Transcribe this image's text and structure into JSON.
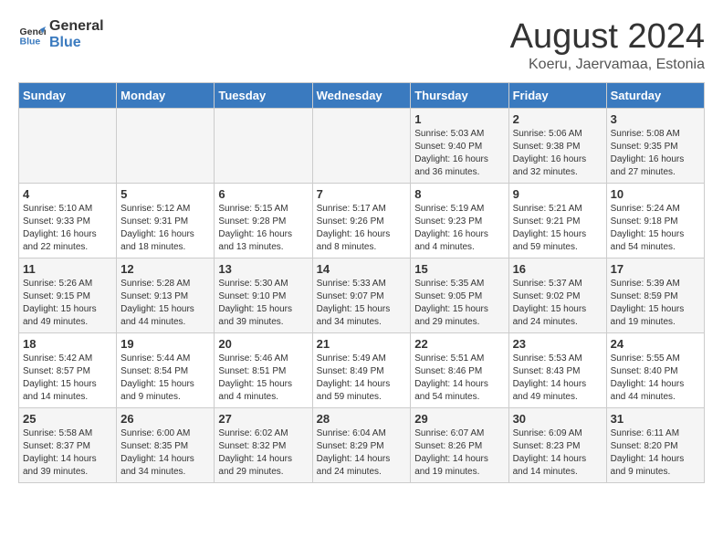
{
  "logo": {
    "line1": "General",
    "line2": "Blue"
  },
  "title": "August 2024",
  "subtitle": "Koeru, Jaervamaa, Estonia",
  "headers": [
    "Sunday",
    "Monday",
    "Tuesday",
    "Wednesday",
    "Thursday",
    "Friday",
    "Saturday"
  ],
  "weeks": [
    [
      {
        "day": "",
        "info": ""
      },
      {
        "day": "",
        "info": ""
      },
      {
        "day": "",
        "info": ""
      },
      {
        "day": "",
        "info": ""
      },
      {
        "day": "1",
        "info": "Sunrise: 5:03 AM\nSunset: 9:40 PM\nDaylight: 16 hours\nand 36 minutes."
      },
      {
        "day": "2",
        "info": "Sunrise: 5:06 AM\nSunset: 9:38 PM\nDaylight: 16 hours\nand 32 minutes."
      },
      {
        "day": "3",
        "info": "Sunrise: 5:08 AM\nSunset: 9:35 PM\nDaylight: 16 hours\nand 27 minutes."
      }
    ],
    [
      {
        "day": "4",
        "info": "Sunrise: 5:10 AM\nSunset: 9:33 PM\nDaylight: 16 hours\nand 22 minutes."
      },
      {
        "day": "5",
        "info": "Sunrise: 5:12 AM\nSunset: 9:31 PM\nDaylight: 16 hours\nand 18 minutes."
      },
      {
        "day": "6",
        "info": "Sunrise: 5:15 AM\nSunset: 9:28 PM\nDaylight: 16 hours\nand 13 minutes."
      },
      {
        "day": "7",
        "info": "Sunrise: 5:17 AM\nSunset: 9:26 PM\nDaylight: 16 hours\nand 8 minutes."
      },
      {
        "day": "8",
        "info": "Sunrise: 5:19 AM\nSunset: 9:23 PM\nDaylight: 16 hours\nand 4 minutes."
      },
      {
        "day": "9",
        "info": "Sunrise: 5:21 AM\nSunset: 9:21 PM\nDaylight: 15 hours\nand 59 minutes."
      },
      {
        "day": "10",
        "info": "Sunrise: 5:24 AM\nSunset: 9:18 PM\nDaylight: 15 hours\nand 54 minutes."
      }
    ],
    [
      {
        "day": "11",
        "info": "Sunrise: 5:26 AM\nSunset: 9:15 PM\nDaylight: 15 hours\nand 49 minutes."
      },
      {
        "day": "12",
        "info": "Sunrise: 5:28 AM\nSunset: 9:13 PM\nDaylight: 15 hours\nand 44 minutes."
      },
      {
        "day": "13",
        "info": "Sunrise: 5:30 AM\nSunset: 9:10 PM\nDaylight: 15 hours\nand 39 minutes."
      },
      {
        "day": "14",
        "info": "Sunrise: 5:33 AM\nSunset: 9:07 PM\nDaylight: 15 hours\nand 34 minutes."
      },
      {
        "day": "15",
        "info": "Sunrise: 5:35 AM\nSunset: 9:05 PM\nDaylight: 15 hours\nand 29 minutes."
      },
      {
        "day": "16",
        "info": "Sunrise: 5:37 AM\nSunset: 9:02 PM\nDaylight: 15 hours\nand 24 minutes."
      },
      {
        "day": "17",
        "info": "Sunrise: 5:39 AM\nSunset: 8:59 PM\nDaylight: 15 hours\nand 19 minutes."
      }
    ],
    [
      {
        "day": "18",
        "info": "Sunrise: 5:42 AM\nSunset: 8:57 PM\nDaylight: 15 hours\nand 14 minutes."
      },
      {
        "day": "19",
        "info": "Sunrise: 5:44 AM\nSunset: 8:54 PM\nDaylight: 15 hours\nand 9 minutes."
      },
      {
        "day": "20",
        "info": "Sunrise: 5:46 AM\nSunset: 8:51 PM\nDaylight: 15 hours\nand 4 minutes."
      },
      {
        "day": "21",
        "info": "Sunrise: 5:49 AM\nSunset: 8:49 PM\nDaylight: 14 hours\nand 59 minutes."
      },
      {
        "day": "22",
        "info": "Sunrise: 5:51 AM\nSunset: 8:46 PM\nDaylight: 14 hours\nand 54 minutes."
      },
      {
        "day": "23",
        "info": "Sunrise: 5:53 AM\nSunset: 8:43 PM\nDaylight: 14 hours\nand 49 minutes."
      },
      {
        "day": "24",
        "info": "Sunrise: 5:55 AM\nSunset: 8:40 PM\nDaylight: 14 hours\nand 44 minutes."
      }
    ],
    [
      {
        "day": "25",
        "info": "Sunrise: 5:58 AM\nSunset: 8:37 PM\nDaylight: 14 hours\nand 39 minutes."
      },
      {
        "day": "26",
        "info": "Sunrise: 6:00 AM\nSunset: 8:35 PM\nDaylight: 14 hours\nand 34 minutes."
      },
      {
        "day": "27",
        "info": "Sunrise: 6:02 AM\nSunset: 8:32 PM\nDaylight: 14 hours\nand 29 minutes."
      },
      {
        "day": "28",
        "info": "Sunrise: 6:04 AM\nSunset: 8:29 PM\nDaylight: 14 hours\nand 24 minutes."
      },
      {
        "day": "29",
        "info": "Sunrise: 6:07 AM\nSunset: 8:26 PM\nDaylight: 14 hours\nand 19 minutes."
      },
      {
        "day": "30",
        "info": "Sunrise: 6:09 AM\nSunset: 8:23 PM\nDaylight: 14 hours\nand 14 minutes."
      },
      {
        "day": "31",
        "info": "Sunrise: 6:11 AM\nSunset: 8:20 PM\nDaylight: 14 hours\nand 9 minutes."
      }
    ]
  ]
}
